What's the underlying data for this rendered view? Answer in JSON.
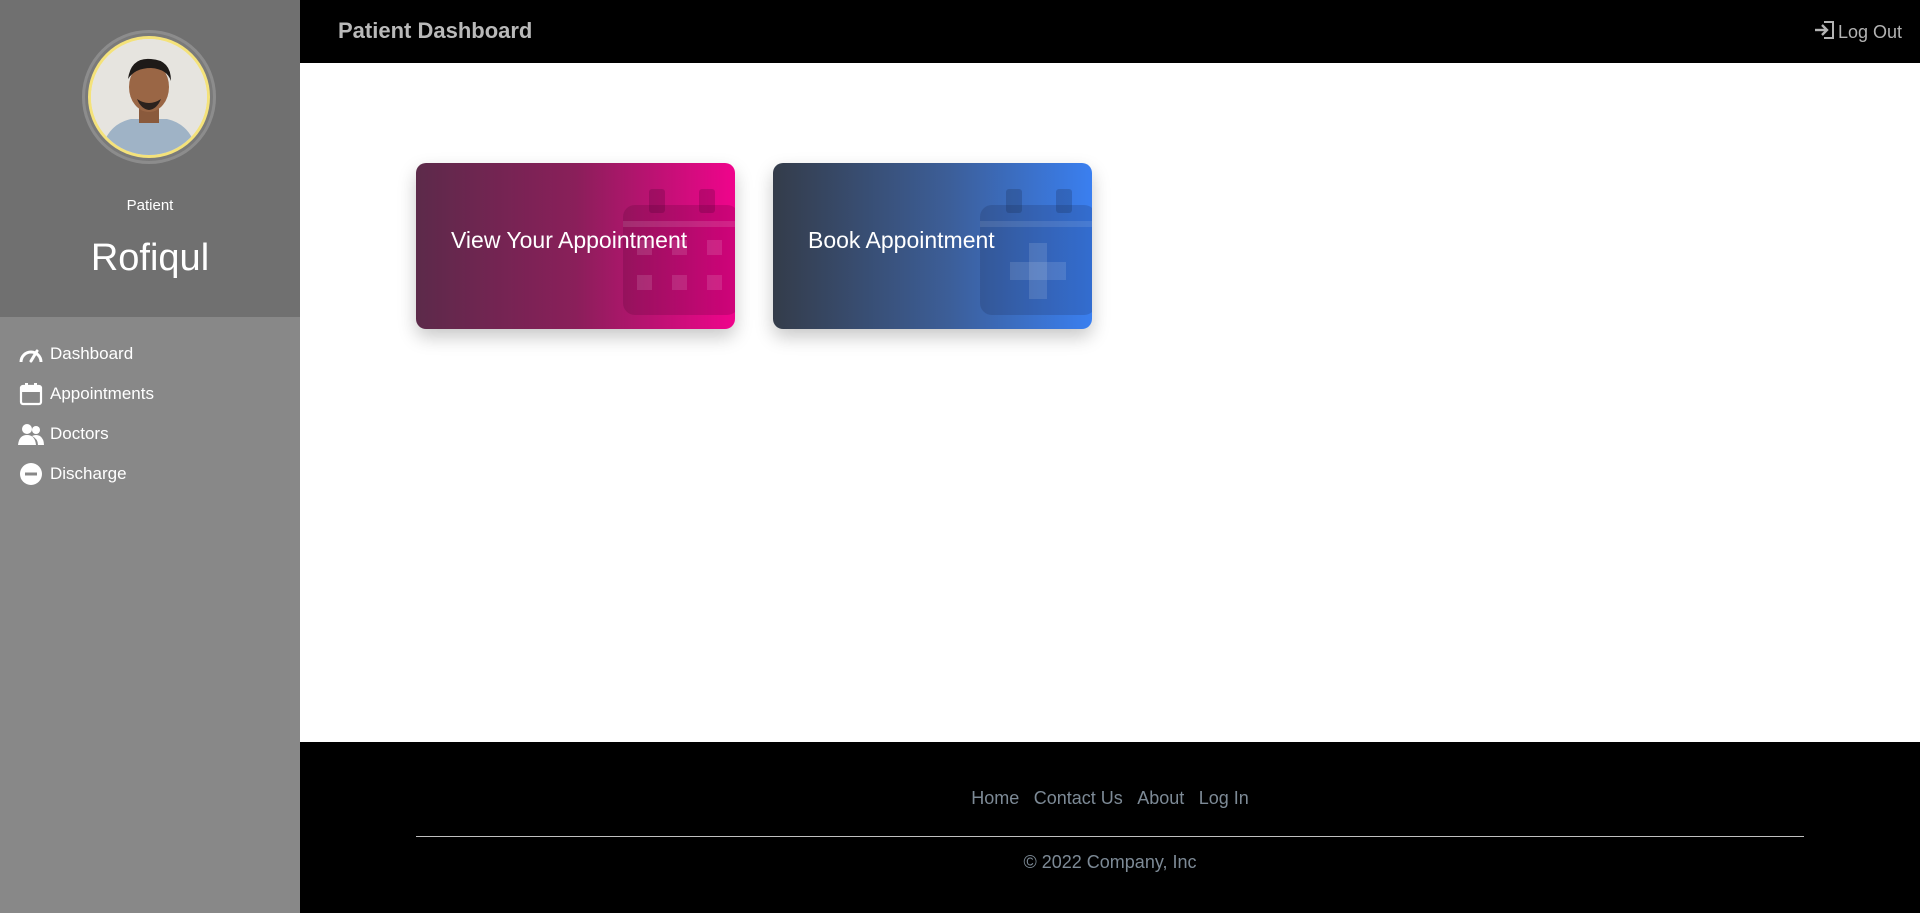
{
  "sidebar": {
    "role": "Patient",
    "name": "Rofiqul",
    "items": [
      {
        "label": "Dashboard",
        "icon": "speedometer-icon"
      },
      {
        "label": "Appointments",
        "icon": "calendar-icon"
      },
      {
        "label": "Doctors",
        "icon": "users-icon"
      },
      {
        "label": "Discharge",
        "icon": "minus-circle-icon"
      }
    ]
  },
  "header": {
    "title": "Patient Dashboard",
    "logout_label": "Log Out"
  },
  "cards": [
    {
      "label": "View Your Appointment",
      "icon": "calendar-grid-icon"
    },
    {
      "label": "Book Appointment",
      "icon": "calendar-plus-icon"
    }
  ],
  "footer": {
    "links": [
      "Home",
      "Contact Us",
      "About",
      "Log In"
    ],
    "copyright": "© 2022 Company, Inc"
  },
  "colors": {
    "sidebar": "#888888",
    "profile_panel": "#707070",
    "topbar": "#000000",
    "view_card_gradient_end": "#f0048c",
    "book_card_gradient_end": "#3a7ff0",
    "avatar_ring": "#f4e27a"
  }
}
